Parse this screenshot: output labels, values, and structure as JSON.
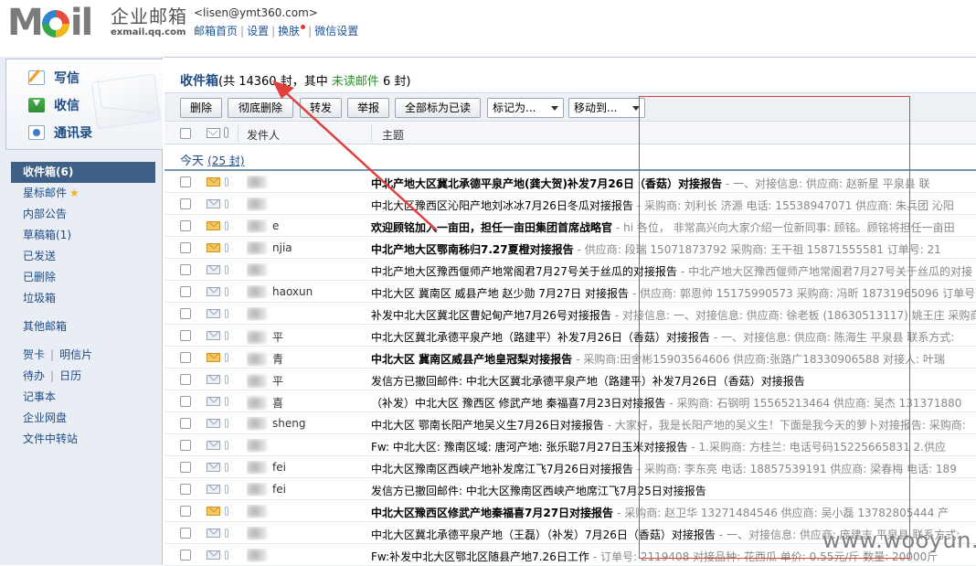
{
  "brand": {
    "logo_text_m": "M",
    "logo_text_il": "il",
    "name_cn": "企业邮箱",
    "name_en": "exmail.qq.com"
  },
  "user": {
    "email": "<lisen@ymt360.com>",
    "links": [
      "邮箱首页",
      "设置",
      "换肤",
      "微信设置"
    ]
  },
  "quick_actions": [
    {
      "label": "写信",
      "icon": "write-icon"
    },
    {
      "label": "收信",
      "icon": "inbox-download-icon"
    },
    {
      "label": "通讯录",
      "icon": "contacts-icon"
    }
  ],
  "folders": [
    {
      "label": "收件箱(6)",
      "active": true
    },
    {
      "label": "星标邮件",
      "star": "★"
    },
    {
      "label": "内部公告"
    },
    {
      "label": "草稿箱(1)"
    },
    {
      "label": "已发送"
    },
    {
      "label": "已删除"
    },
    {
      "label": "垃圾箱"
    }
  ],
  "other_folders": {
    "label": "其他邮箱"
  },
  "tools": [
    [
      "贺卡",
      "明信片"
    ],
    [
      "待办",
      "日历"
    ],
    [
      "记事本"
    ],
    [
      "企业网盘"
    ],
    [
      "文件中转站"
    ]
  ],
  "mailbox": {
    "title": "收件箱",
    "count_prefix": "(共 ",
    "count": "14360",
    "count_mid": " 封，其中 ",
    "unread_label": "未读邮件",
    "unread_count": " 6 封)"
  },
  "toolbar": {
    "delete": "删除",
    "delete_forever": "彻底删除",
    "forward": "转发",
    "report": "举报",
    "mark_all_read": "全部标为已读",
    "mark_as": "标记为...",
    "move_to": "移动到..."
  },
  "columns": {
    "sender": "发件人",
    "subject": "主题"
  },
  "group": {
    "label": "今天",
    "count": "(25 封)"
  },
  "rows": [
    {
      "status": "unread",
      "sender": "",
      "subject": "中北产地大区冀北承德平泉产地(龚大贺)补发7月26日（香菇）对接报告",
      "preview": "- 一、对接信息: 供应商: 赵新星 平泉县 联",
      "bold": true
    },
    {
      "status": "opened",
      "sender": "",
      "subject": "中北大区豫西区沁阳产地刘冰冰7月26日冬瓜对接报告",
      "preview": "- 采购商: 刘利长 济源 电话: 15538947071 供应商: 朱兵团 沁阳",
      "bold": false
    },
    {
      "status": "unread",
      "sender": "e",
      "subject": "欢迎顾铭加入一亩田，担任一亩田集团首席战略官",
      "preview": "- hi 各位， 非常高兴向大家介绍一位新同事: 顾铭。顾铭将担任一亩田",
      "bold": true
    },
    {
      "status": "unread",
      "sender": "njia",
      "subject": "中北产地大区鄂南秭归7.27夏橙对接报告",
      "preview": "- 供应商: 段瑞 15071873792 采购商: 王干祖 15871555581 订单号: 21",
      "bold": true
    },
    {
      "status": "opened",
      "sender": "",
      "subject": "中北产地大区豫西偃师产地常阁君7月27号关于丝瓜的对接报告",
      "preview": "- 中北产地大区豫西偃师产地常阁君7月27号关于丝瓜的对接",
      "bold": false
    },
    {
      "status": "opened",
      "sender": "haoxun",
      "subject": "中北大区 冀南区 威县产地 赵少勋 7月27日 对接报告",
      "preview": "- 供应商: 郭恩帅 15175990573 采购商: 冯昕 18731965096 订单号",
      "bold": false
    },
    {
      "status": "opened",
      "sender": "",
      "subject": "补发中北大区冀北区曹妃甸产地7月26号对接报告",
      "preview": "- 对接信息: 一、对接信息: 供应商: 徐老板 (18630513117) 姚王庄 采购商: 刘老板",
      "bold": false
    },
    {
      "status": "opened",
      "sender": "平",
      "subject": "中北大区冀北承德平泉产地（路建平）补发7月26日（香菇）对接报告",
      "preview": "- 一、对接信息: 供应商: 陈海生 平泉县 联系方式:",
      "bold": false
    },
    {
      "status": "unread",
      "sender": "青",
      "subject": "中北大区 冀南区威县产地皇冠梨对接报告",
      "preview": "- 采购商:田舍彬15903564606 供应商:张路广18330906588 对接人: 叶瑞",
      "bold": true
    },
    {
      "status": "opened",
      "sender": "平",
      "subject": "发信方已撤回邮件: 中北大区冀北承德平泉产地（路建平）补发7月26日（香菇）对接报告",
      "preview": "",
      "bold": false
    },
    {
      "status": "opened",
      "sender": "喜",
      "subject": "（补发）中北大区 豫西区 修武产地 秦福喜7月23日对接报告",
      "preview": "- 采购商: 石钢明 15565213464 供应商: 吴杰 131371880",
      "bold": false
    },
    {
      "status": "opened",
      "sender": "sheng",
      "subject": "中北大区 鄂南长阳产地吴义生7月26日对接报告",
      "preview": "- 大家好，我是长阳产地的吴义生！下面是我今天的萝卜对接报告: 采购商:",
      "bold": false
    },
    {
      "status": "opened",
      "sender": "",
      "subject": "Fw: 中北大区: 豫南区域: 唐河产地: 张乐聪7月27日玉米对接报告",
      "preview": "- 1.采购商: 方桂兰: 电话号码15225665831 2.供应",
      "bold": false
    },
    {
      "status": "opened",
      "sender": "fei",
      "subject": "中北大区豫南区西峡产地补发席江飞7月26日对接报告",
      "preview": "- 采购商: 李东亮 电话: 18857539191 供应商: 梁春梅 电话: 189",
      "bold": false
    },
    {
      "status": "opened",
      "sender": "fei",
      "subject": "发信方已撤回邮件: 中北大区豫南区西峡产地席江飞7月25日对接报告",
      "preview": "",
      "bold": false
    },
    {
      "status": "unread",
      "sender": "",
      "subject": "中北大区豫西区修武产地秦福喜7月27日对接报告",
      "preview": "- 采购商: 赵卫华 13271484546 供应商: 吴小磊 13782805444 产",
      "bold": true
    },
    {
      "status": "opened",
      "sender": "",
      "subject": "中北大区冀北承德平泉产地（王磊）（补发）7月26日（香菇）对接报告",
      "preview": "- 一、对接信息: 供应商: 庞建志 平泉县 联系方式:",
      "bold": false
    },
    {
      "status": "opened",
      "sender": "",
      "subject": "Fw:补发中北大区鄂北区随县产地7.26日工作",
      "preview": "- 订单号: 2119408 对接品种: 花西瓜 单价: 0.55元/斤 数量: 20000斤",
      "bold": false
    }
  ],
  "watermark": "www.wooyun.org",
  "colors": {
    "link": "#1e5494",
    "active_folder": "#3e5f86",
    "annotation_red": "#e0403a",
    "unread_green": "#2a8f2a"
  }
}
